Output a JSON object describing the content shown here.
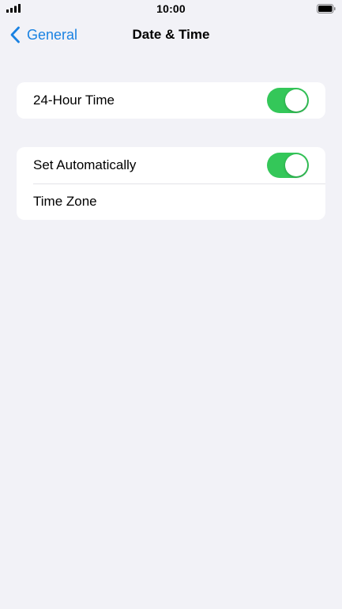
{
  "status_bar": {
    "time": "10:00",
    "signal_icon": "cellular-signal-icon",
    "battery_icon": "battery-icon"
  },
  "nav": {
    "back_label": "General",
    "title": "Date & Time"
  },
  "settings": {
    "hour24": {
      "label": "24-Hour Time",
      "enabled": true
    },
    "set_automatically": {
      "label": "Set Automatically",
      "enabled": true
    },
    "time_zone": {
      "label": "Time Zone"
    }
  },
  "colors": {
    "accent": "#1a82e2",
    "toggle_on": "#34c759",
    "background": "#f2f2f7"
  }
}
